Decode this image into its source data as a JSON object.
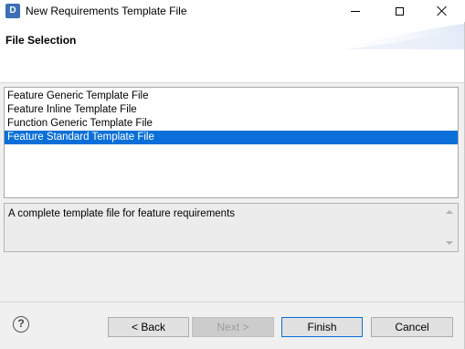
{
  "window": {
    "title": "New Requirements Template File",
    "icon_letter": "D"
  },
  "banner": {
    "title": "File Selection"
  },
  "list": {
    "items": [
      "Feature Generic Template File",
      "Feature Inline Template File",
      "Function Generic Template File",
      "Feature Standard Template File"
    ],
    "selected": "Feature Standard Template File"
  },
  "description": {
    "text": "A complete template file for feature requirements"
  },
  "help": {
    "glyph": "?"
  },
  "buttons": {
    "back": "< Back",
    "next": "Next >",
    "finish": "Finish",
    "cancel": "Cancel"
  },
  "colors": {
    "selection": "#0a6fd8",
    "app_icon": "#3b6fb6"
  }
}
